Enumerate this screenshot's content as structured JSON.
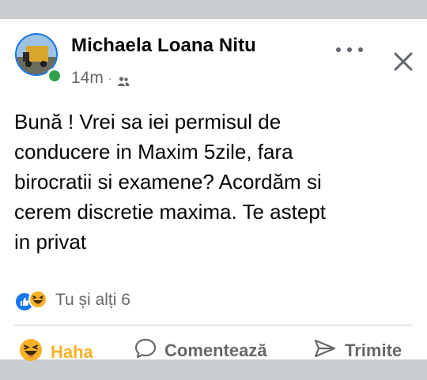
{
  "post": {
    "author": "Michaela Loana Nitu",
    "time": "14m",
    "separator": "·",
    "audience_icon": "friends-icon",
    "body": "Bună ! Vrei sa iei permisul de\nconducere in Maxim 5zile, fara\nbirocratii si examene? Acordăm si\ncerem discretie maxima. Te astept\nin privat"
  },
  "reactions": {
    "icons": [
      "like-icon",
      "haha-icon"
    ],
    "summary": "Tu și alți 6"
  },
  "actions": {
    "haha_label": "Haha",
    "comment_label": "Comentează",
    "share_label": "Trimite"
  },
  "colors": {
    "accent": "#1877f2",
    "haha": "#f7b125",
    "online": "#31a24c",
    "secondary_text": "#65676b"
  }
}
